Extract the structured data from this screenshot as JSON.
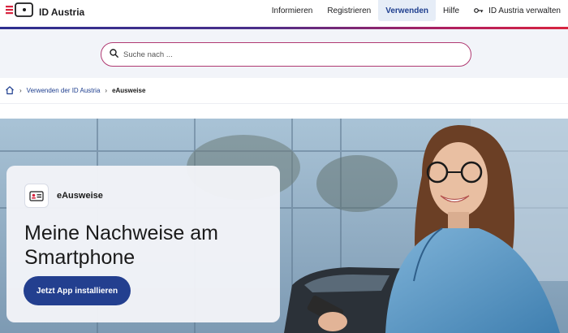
{
  "header": {
    "logo_text": "ID Austria",
    "nav": [
      {
        "label": "Informieren"
      },
      {
        "label": "Registrieren"
      },
      {
        "label": "Verwenden",
        "active": true
      },
      {
        "label": "Hilfe"
      },
      {
        "label": "ID Austria verwalten",
        "icon": "key-icon"
      }
    ]
  },
  "search": {
    "placeholder": "Suche nach ..."
  },
  "breadcrumb": {
    "home_icon": "home-icon",
    "items": [
      "Verwenden der ID Austria",
      "eAusweise"
    ]
  },
  "hero": {
    "badge_label": "eAusweise",
    "badge_icon": "id-card-icon",
    "title": "Meine Nachweise am Smartphone",
    "cta_label": "Jetzt App installieren"
  },
  "colors": {
    "accent_blue": "#233f8f",
    "search_border": "#b03a72",
    "active_nav_bg": "#e6edf7"
  }
}
